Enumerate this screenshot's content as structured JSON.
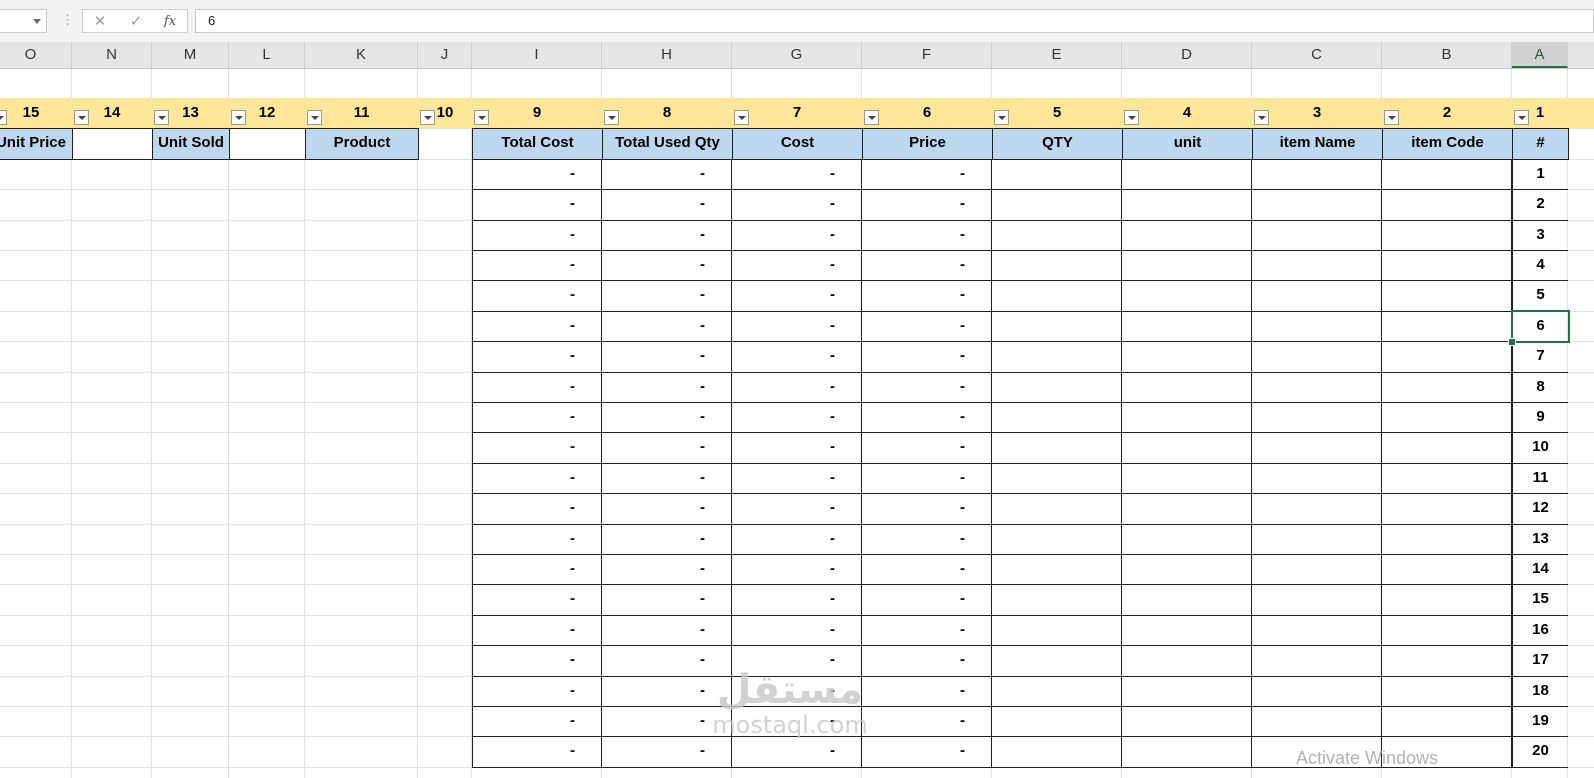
{
  "formula_bar": {
    "name_box": "",
    "cancel_icon": "✕",
    "enter_icon": "✓",
    "fx_label": "fx",
    "value": "6"
  },
  "columns": [
    "O",
    "N",
    "M",
    "L",
    "K",
    "J",
    "I",
    "H",
    "G",
    "F",
    "E",
    "D",
    "C",
    "B",
    "A"
  ],
  "active_column": "A",
  "number_row": {
    "O": "15",
    "N": "14",
    "M": "13",
    "L": "12",
    "K": "11",
    "J": "10",
    "I": "9",
    "H": "8",
    "G": "7",
    "F": "6",
    "E": "5",
    "D": "4",
    "C": "3",
    "B": "2",
    "A": "1"
  },
  "header_row": {
    "O": "Unit Price",
    "N": "",
    "M": "Unit Sold",
    "L": "",
    "K": "Product",
    "I": "Total Cost",
    "H": "Total  Used Qty",
    "G": "Cost",
    "F": "Price",
    "E": "QTY",
    "D": "unit",
    "C": "item Name",
    "B": "item Code",
    "A": "#"
  },
  "rows": [
    {
      "idx": "1",
      "I": "-",
      "H": "-",
      "G": "-",
      "F": "-"
    },
    {
      "idx": "2",
      "I": "-",
      "H": "-",
      "G": "-",
      "F": "-"
    },
    {
      "idx": "3",
      "I": "-",
      "H": "-",
      "G": "-",
      "F": "-"
    },
    {
      "idx": "4",
      "I": "-",
      "H": "-",
      "G": "-",
      "F": "-"
    },
    {
      "idx": "5",
      "I": "-",
      "H": "-",
      "G": "-",
      "F": "-"
    },
    {
      "idx": "6",
      "I": "-",
      "H": "-",
      "G": "-",
      "F": "-"
    },
    {
      "idx": "7",
      "I": "-",
      "H": "-",
      "G": "-",
      "F": "-"
    },
    {
      "idx": "8",
      "I": "-",
      "H": "-",
      "G": "-",
      "F": "-"
    },
    {
      "idx": "9",
      "I": "-",
      "H": "-",
      "G": "-",
      "F": "-"
    },
    {
      "idx": "10",
      "I": "-",
      "H": "-",
      "G": "-",
      "F": "-"
    },
    {
      "idx": "11",
      "I": "-",
      "H": "-",
      "G": "-",
      "F": "-"
    },
    {
      "idx": "12",
      "I": "-",
      "H": "-",
      "G": "-",
      "F": "-"
    },
    {
      "idx": "13",
      "I": "-",
      "H": "-",
      "G": "-",
      "F": "-"
    },
    {
      "idx": "14",
      "I": "-",
      "H": "-",
      "G": "-",
      "F": "-"
    },
    {
      "idx": "15",
      "I": "-",
      "H": "-",
      "G": "-",
      "F": "-"
    },
    {
      "idx": "16",
      "I": "-",
      "H": "-",
      "G": "-",
      "F": "-"
    },
    {
      "idx": "17",
      "I": "-",
      "H": "-",
      "G": "-",
      "F": "-"
    },
    {
      "idx": "18",
      "I": "-",
      "H": "-",
      "G": "-",
      "F": "-"
    },
    {
      "idx": "19",
      "I": "-",
      "H": "-",
      "G": "-",
      "F": "-"
    },
    {
      "idx": "20",
      "I": "-",
      "H": "-",
      "G": "-",
      "F": "-"
    }
  ],
  "selected_cell": {
    "col": "A",
    "row": "6"
  },
  "colors": {
    "number_row_fill": "#ffe699",
    "header_fill": "#bdd7ee",
    "selection": "#217346"
  },
  "watermark": {
    "arabic": "مستقل",
    "latin": "mostaql.com"
  },
  "activate_windows": "Activate Windows"
}
